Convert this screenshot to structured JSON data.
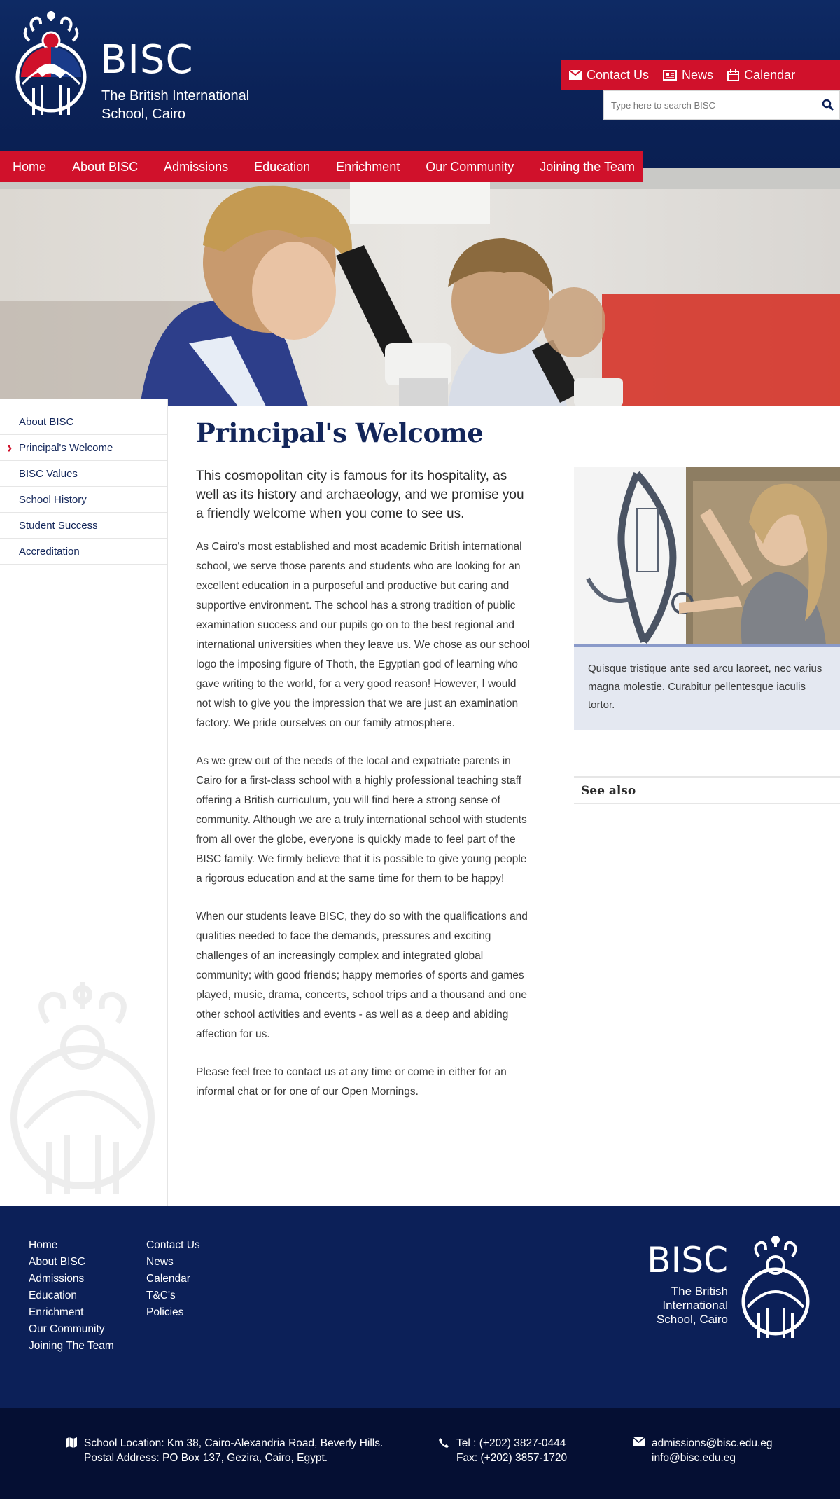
{
  "brand": {
    "name": "BISC",
    "subtitle": "The British International School, Cairo"
  },
  "utility_nav": [
    {
      "label": "Contact Us",
      "icon": "envelope-icon"
    },
    {
      "label": "News",
      "icon": "newspaper-icon"
    },
    {
      "label": "Calendar",
      "icon": "calendar-icon"
    }
  ],
  "search": {
    "placeholder": "Type here to search BISC",
    "value": ""
  },
  "main_nav": [
    "Home",
    "About BISC",
    "Admissions",
    "Education",
    "Enrichment",
    "Our Community",
    "Joining the Team"
  ],
  "sidebar": {
    "items": [
      {
        "label": "About BISC",
        "active": false
      },
      {
        "label": "Principal's Welcome",
        "active": true
      },
      {
        "label": "BISC Values",
        "active": false
      },
      {
        "label": "School History",
        "active": false
      },
      {
        "label": "Student Success",
        "active": false
      },
      {
        "label": "Accreditation",
        "active": false
      }
    ]
  },
  "page": {
    "title": "Principal's Welcome",
    "intro": "This cosmopolitan city is famous for its hospitality, as well as its  history and archaeology, and we promise you a friendly welcome when you come to see us.",
    "paragraphs": [
      "As Cairo's most established and most academic British international school, we serve those parents and students who are looking for an excellent education in a purposeful and productive but caring and supportive environment. The school has a strong tradition of public examination success and our pupils go on to the best regional and international universities when they leave us. We chose as our school logo the imposing figure of Thoth, the Egyptian god of learning who gave writing to the world, for a very good reason! However, I would not wish to give you the impression that we are just an examination factory. We pride ourselves on our family atmosphere.",
      "As we grew out of the needs of the local and expatriate parents in Cairo for a first-class school with a highly professional teaching staff offering a British curriculum, you will find here a strong sense of community. Although we are a truly international school with students from all over the globe, everyone is quickly made to feel part of the BISC family. We firmly believe that it is possible to give young people a rigorous education and at the same time for them to be happy!",
      "When our students leave BISC, they do so with the qualifications and qualities needed to face the demands, pressures and exciting challenges of an increasingly complex and integrated global community; with good friends; happy memories of sports and games played, music, drama, concerts, school trips and a thousand and one other school activities and events - as well as a deep and abiding affection for us.",
      "Please feel free to contact us at any time or come in either for an informal chat or for one of our Open Mornings."
    ]
  },
  "feature": {
    "caption": "Quisque tristique ante sed arcu laoreet, nec varius magna molestie. Curabitur pellentesque iaculis tortor."
  },
  "see_also": {
    "title": "See also"
  },
  "footer": {
    "col1": [
      "Home",
      "About BISC",
      "Admissions",
      "Education",
      "Enrichment",
      "Our Community",
      "Joining The Team"
    ],
    "col2": [
      "Contact Us",
      "News",
      "Calendar",
      "T&C's",
      "Policies"
    ],
    "brand_name": "BISC",
    "brand_sub": "The British International School, Cairo"
  },
  "contact_bar": {
    "location": "School Location: Km 38, Cairo-Alexandria Road, Beverly Hills.",
    "postal": "Postal Address: PO Box 137, Gezira, Cairo, Egypt.",
    "tel": "Tel : (+202) 3827-0444",
    "fax": "Fax: (+202) 3857-1720",
    "email1": "admissions@bisc.edu.eg",
    "email2": "info@bisc.edu.eg"
  },
  "colors": {
    "navy": "#0c2058",
    "red": "#d0112b",
    "dark_navy": "#050f33",
    "caption_bg": "#e4e8f1"
  }
}
